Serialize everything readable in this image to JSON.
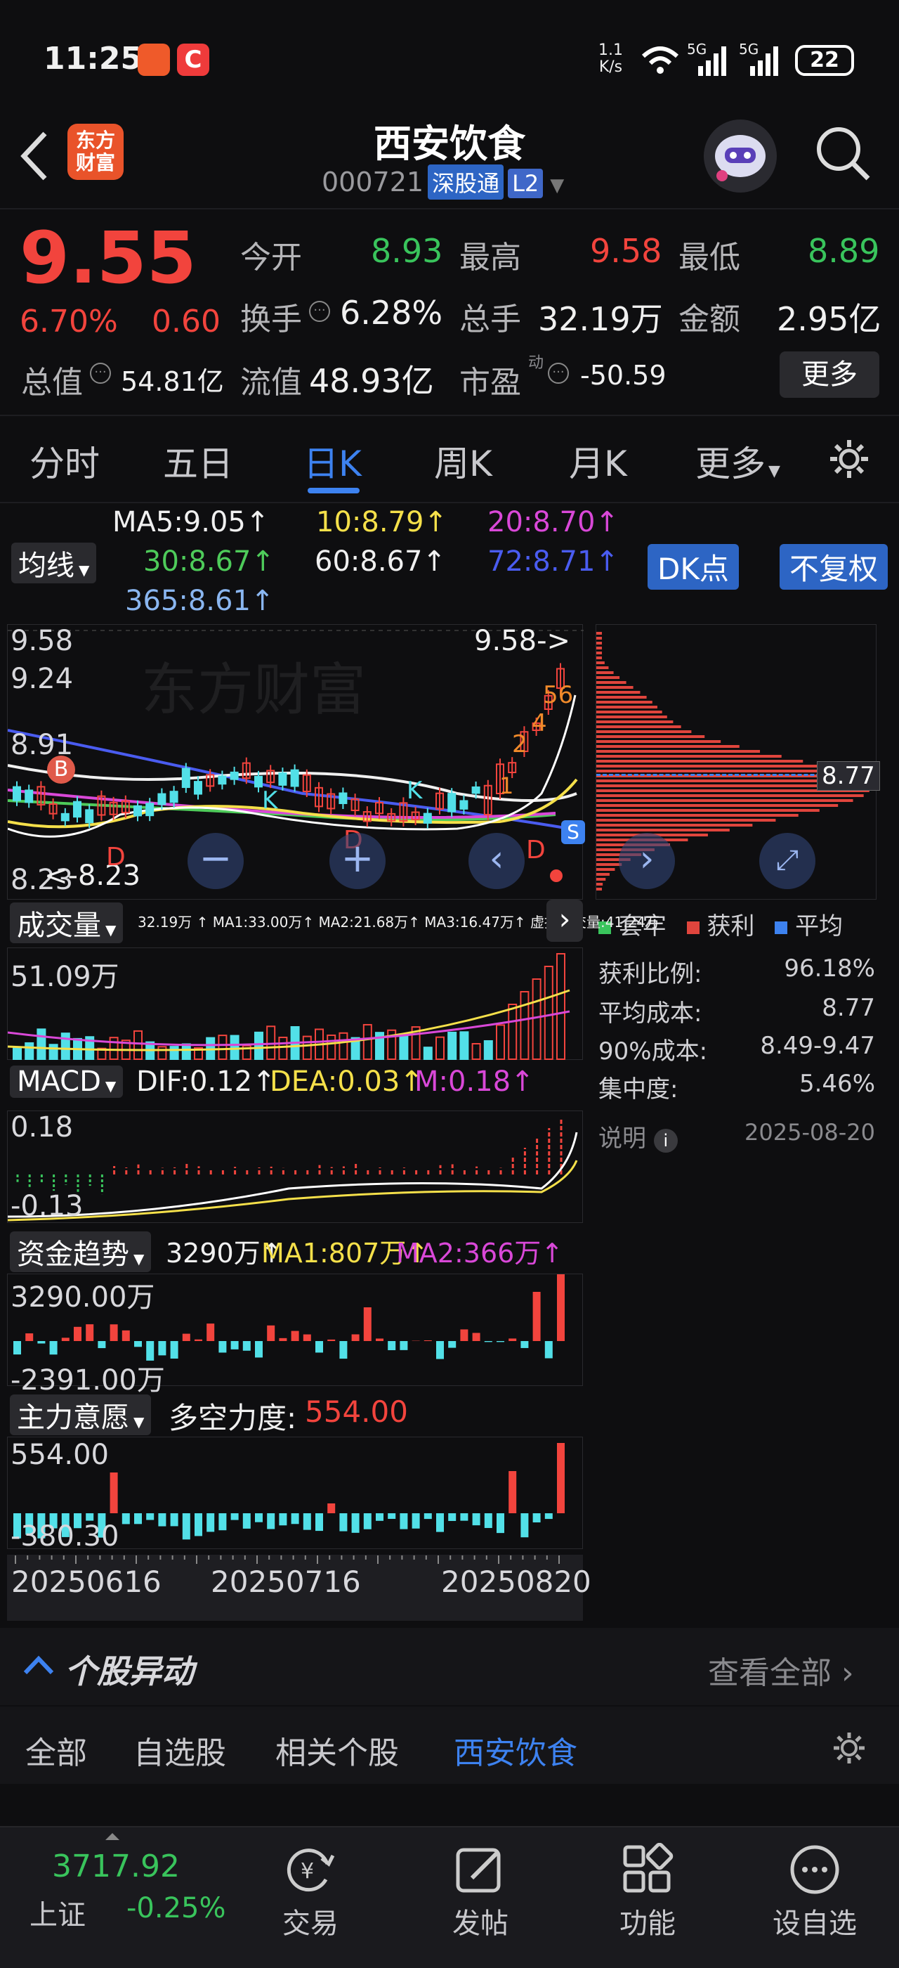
{
  "status_bar": {
    "time": "11:25",
    "net_speed_top": "1.1",
    "net_speed_bottom": "K/s",
    "signal1": "5G",
    "signal2": "5G",
    "battery": "22"
  },
  "header": {
    "title": "西安饮食",
    "code": "000721",
    "tag": "深股通",
    "level": "L2",
    "logo_line1": "东方",
    "logo_line2": "财富"
  },
  "quote": {
    "price": "9.55",
    "change_pct": "6.70%",
    "change": "0.60",
    "open_label": "今开",
    "open": "8.93",
    "high_label": "最高",
    "high": "9.58",
    "low_label": "最低",
    "low": "8.89",
    "turnover_label": "换手",
    "turnover": "6.28%",
    "volume_label": "总手",
    "volume": "32.19万",
    "amount_label": "金额",
    "amount": "2.95亿",
    "mktcap_label": "总值",
    "mktcap": "54.81亿",
    "float_label": "流值",
    "float": "48.93亿",
    "pe_label": "市盈",
    "pe_sup": "动",
    "pe": "-50.59",
    "more": "更多"
  },
  "tabs": [
    "分时",
    "五日",
    "日K",
    "周K",
    "月K",
    "更多"
  ],
  "active_tab": 2,
  "ma": {
    "ma5": "MA5:9.05↑",
    "ma10": "10:8.79↑",
    "ma20": "20:8.70↑",
    "ma30": "30:8.67↑",
    "ma60": "60:8.67↑",
    "ma72": "72:8.71↑",
    "ma365": "365:8.61↑",
    "selector": "均线",
    "dk": "DK点",
    "adjust": "不复权"
  },
  "kline": {
    "p_high": "9.58",
    "p_2": "9.24",
    "p_3": "8.91",
    "p_low": "8.23",
    "max_mark": "9.58->",
    "min_mark": "<-8.23",
    "markers": {
      "b": "B",
      "d": "D",
      "k": "K",
      "s": "S",
      "n1": "1",
      "n2": "2",
      "n4": "4",
      "n56": "56"
    }
  },
  "chip": {
    "avg_line": "8.77",
    "legend": [
      "套牢",
      "获利",
      "平均"
    ],
    "stats": [
      {
        "label": "获利比例:",
        "value": "96.18%"
      },
      {
        "label": "平均成本:",
        "value": "8.77"
      },
      {
        "label": "90%成本:",
        "value": "8.49-9.47"
      },
      {
        "label": "集中度:",
        "value": "5.46%"
      }
    ],
    "note": "说明",
    "date": "2025-08-20"
  },
  "volume": {
    "selector": "成交量",
    "info": "32.19万 ↑ MA1:33.00万↑ MA2:21.68万↑ MA3:16.47万↑ 虚拟成交量:41.24万",
    "top": "51.09万"
  },
  "macd": {
    "selector": "MACD",
    "dif": "DIF:0.12↑",
    "dea": "DEA:0.03↑",
    "m": "M:0.18↑",
    "top": "0.18",
    "bottom": "-0.13"
  },
  "fund": {
    "selector": "资金趋势",
    "val": "3290万↑",
    "ma1": "MA1:807万↑",
    "ma2": "MA2:366万↑",
    "top": "3290.00万",
    "bottom": "-2391.00万"
  },
  "main_force": {
    "selector": "主力意愿",
    "label": "多空力度:",
    "value": "554.00",
    "top": "554.00",
    "bottom": "-380.30"
  },
  "dates": [
    "20250616",
    "20250716",
    "20250820"
  ],
  "movement": {
    "title": "个股异动",
    "view_all": "查看全部"
  },
  "filter_tabs": [
    "全部",
    "自选股",
    "相关个股",
    "西安饮食"
  ],
  "bottom_bar": {
    "index_value": "3717.92",
    "index_name": "上证",
    "index_change": "-0.25%",
    "trade": "交易",
    "post": "发帖",
    "func": "功能",
    "watch": "设自选"
  },
  "colors": {
    "up": "#f2443d",
    "down": "#39c45c",
    "accent": "#3d82f0",
    "cyan": "#52e0e8",
    "bg": "#0e0e10"
  }
}
